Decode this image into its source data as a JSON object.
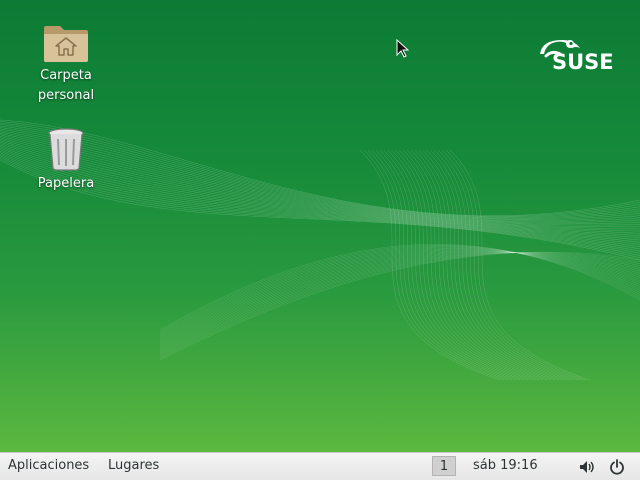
{
  "desktop": {
    "icons": [
      {
        "label_line1": "Carpeta",
        "label_line2": "personal",
        "icon": "home-folder-icon"
      },
      {
        "label_line1": "Papelera",
        "icon": "trash-icon"
      }
    ],
    "logo_text": "SUSE",
    "colors": {
      "background_top": "#0c7b35",
      "background_bottom": "#5cb83f"
    }
  },
  "taskbar": {
    "applications_label": "Aplicaciones",
    "places_label": "Lugares",
    "workspace_number": "1",
    "clock": "sáb 19:16",
    "tray_icons": [
      "volume-icon",
      "power-icon"
    ]
  }
}
